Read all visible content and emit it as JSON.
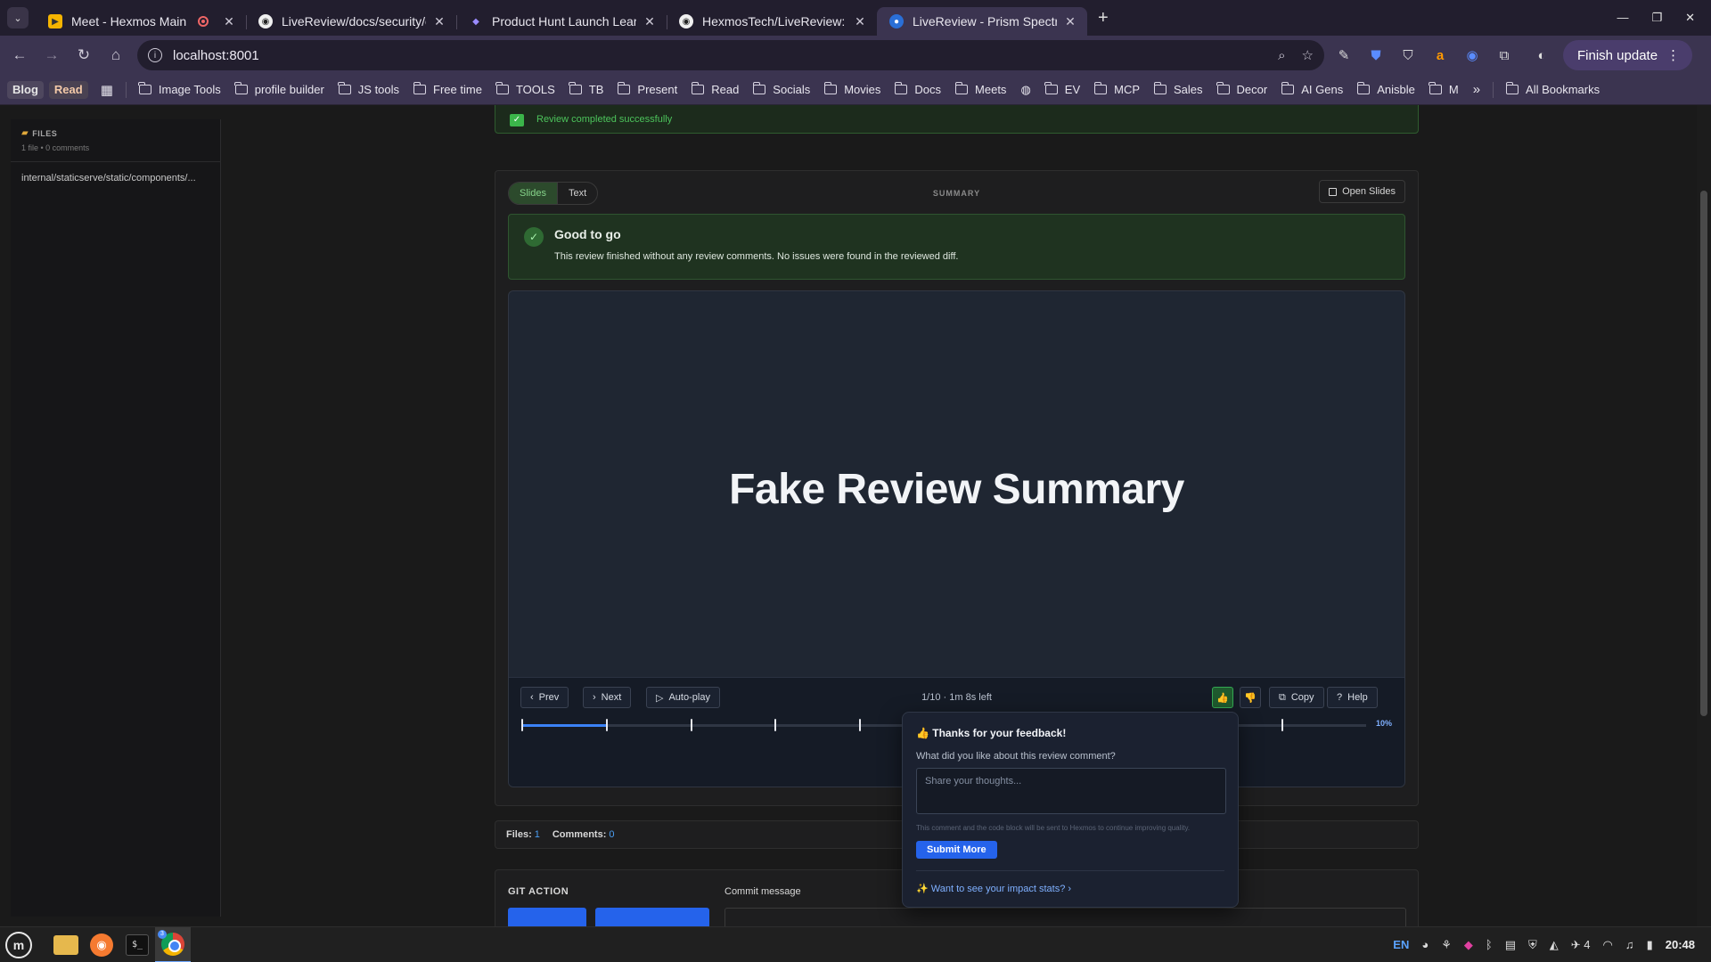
{
  "browser": {
    "tabs": [
      {
        "title": "Meet - Hexmos Main",
        "icon": "meet-icon",
        "recording": true,
        "active": false
      },
      {
        "title": "LiveReview/docs/security/o",
        "icon": "github-icon",
        "active": false
      },
      {
        "title": "Product Hunt Launch Learni",
        "icon": "product-hunt-icon",
        "active": false
      },
      {
        "title": "HexmosTech/LiveReview: A",
        "icon": "github-icon",
        "active": false
      },
      {
        "title": "LiveReview - Prism Spectrum",
        "icon": "livereview-icon",
        "active": true
      }
    ],
    "url": "localhost:8001",
    "finish_update_label": "Finish update",
    "bookmarks_chips": [
      "Blog",
      "Read"
    ],
    "bookmarks": [
      "Image Tools",
      "profile builder",
      "JS tools",
      "Free time",
      "TOOLS",
      "TB",
      "Present",
      "Read",
      "Socials",
      "Movies",
      "Docs",
      "Meets"
    ],
    "bookmarks_after_globe": [
      "EV",
      "MCP",
      "Sales",
      "Decor",
      "AI Gens",
      "Anisble",
      "M"
    ],
    "all_bookmarks_label": "All Bookmarks",
    "overflow": "»"
  },
  "sidebar": {
    "title": "FILES",
    "meta": "1 file • 0 comments",
    "files": [
      "internal/staticserve/static/components/..."
    ]
  },
  "review": {
    "success_text": "Review completed successfully",
    "tabs": [
      "Slides",
      "Text"
    ],
    "active_tab": "Slides",
    "summary_label": "SUMMARY",
    "open_slides_label": "Open Slides",
    "status_title": "Good to go",
    "status_text": "This review finished without any review comments. No issues were found in the reviewed diff.",
    "slide_title": "Fake Review Summary",
    "controls": {
      "prev": "Prev",
      "next": "Next",
      "autoplay": "Auto-play",
      "position": "1/10 · 1m 8s left",
      "copy": "Copy",
      "help": "Help",
      "progress_percent": "10%",
      "progress_fraction": 0.1,
      "slide_count": 10
    }
  },
  "stats": {
    "files_label": "Files:",
    "files_value": "1",
    "comments_label": "Comments:",
    "comments_value": "0"
  },
  "git": {
    "title": "GIT ACTION",
    "commit_label": "Commit message"
  },
  "feedback": {
    "title": "👍 Thanks for your feedback!",
    "question": "What did you like about this review comment?",
    "placeholder": "Share your thoughts...",
    "note": "This comment and the code block will be sent to Hexmos to continue improving quality.",
    "submit": "Submit More",
    "impact_link": "✨ Want to see your impact stats?  ›"
  },
  "taskbar": {
    "lang": "EN",
    "workspace_count": "4",
    "chrome_badge": "3",
    "time": "20:48"
  },
  "colors": {
    "accent_blue": "#2563eb",
    "success_green": "#4cc35b",
    "browser_frame": "#3b3450"
  }
}
